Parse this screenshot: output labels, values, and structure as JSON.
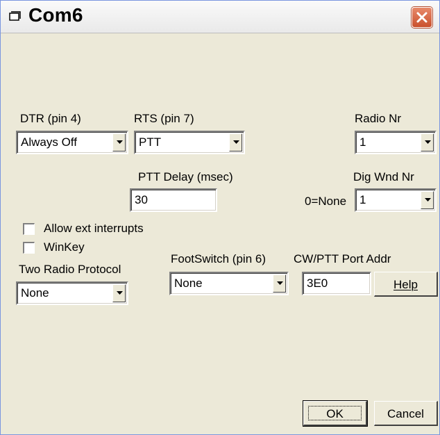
{
  "window": {
    "title": "Com6"
  },
  "labels": {
    "dtr": "DTR (pin 4)",
    "rts": "RTS (pin 7)",
    "radio_nr": "Radio Nr",
    "ptt_delay": "PTT Delay  (msec)",
    "dig_wnd_nr": "Dig Wnd Nr",
    "zero_none": "0=None",
    "allow_ext": "Allow ext interrupts",
    "winkey": "WinKey",
    "two_radio": "Two Radio Protocol",
    "footswitch": "FootSwitch (pin 6)",
    "cw_ptt_addr": "CW/PTT Port Addr"
  },
  "fields": {
    "dtr": "Always Off",
    "rts": "PTT",
    "radio_nr": "1",
    "ptt_delay": "30",
    "dig_wnd_nr": "1",
    "two_radio": "None",
    "footswitch": "None",
    "port_addr": "3E0"
  },
  "checkboxes": {
    "allow_ext": false,
    "winkey": false
  },
  "buttons": {
    "help": "Help",
    "ok": "OK",
    "cancel": "Cancel"
  }
}
